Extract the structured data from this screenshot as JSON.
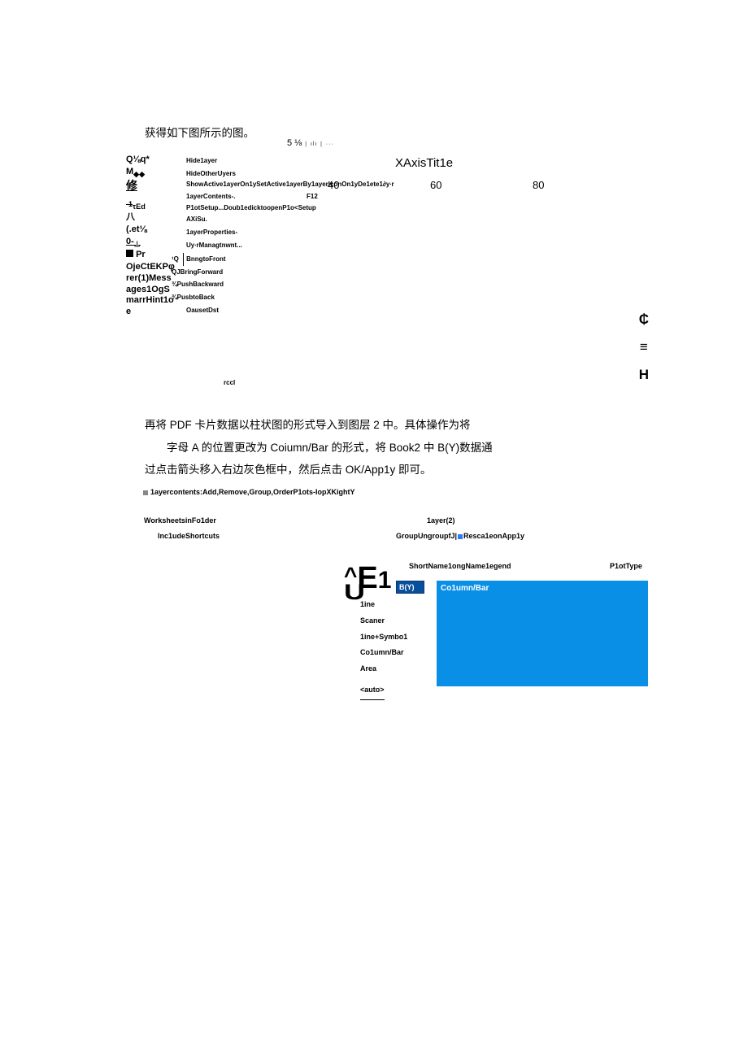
{
  "para1": "获得如下图所示的图。",
  "toprow": {
    "num": "5  ⅛",
    "bars": "∣ ılı ∣ ···"
  },
  "chart": {
    "title": "XAxisTit1e",
    "ticks": {
      "t40": "40",
      "t60": "60",
      "t80": "80"
    }
  },
  "leftcol": {
    "l1": "Q⅛q*",
    "l2a": "M",
    "l2b": "◆◆",
    "l3": "修",
    "l4a": "-1",
    "l4b": "τEd",
    "l5": "八",
    "l6": "(.et⅛",
    "l7": "0-",
    "l8": "Pr",
    "l9": "OjeCtEKPφrer(1)Messages1OgSmarrHint1oe"
  },
  "menu": {
    "m1": "Hide1ayer",
    "m2": "HideOtherUyers",
    "m3": "ShowActive1ayerOn1ySetActive1ayerBy1ayerIconOn1yDe1ete1∂y∙r",
    "m4": "1ayerContents-.",
    "m4s": "F12",
    "m5": "P1otSetup...Doub1edicktoopenP1o<Setup",
    "m6": "AXiSu.",
    "m7": "1ayerProperties-",
    "m8": "Uy∙rManagtnwnt...",
    "m9a": "¹Q",
    "m9b": "BnngtoFront",
    "m10": "QJBringForward",
    "m11": "¾PushBackward",
    "m12": "¾PusbtoBack",
    "m13": "OausetDst",
    "rccl": "rccl"
  },
  "rsym": {
    "s1": "₵",
    "s2": "≡",
    "s3": "H"
  },
  "para2": {
    "line1": "再将 PDF 卡片数据以柱状图的形式导入到图层 2 中。具体操作为将",
    "line2": "字母 A 的位置更改为 Coiumn/Bar 的形式，将 Book2 中 B(Y)数据通",
    "line3": "过点击箭头移入右边灰色框中，然后点击 OK/App1y 即可。"
  },
  "caption1": "1ayercontents:Add,Remove,Group,OrderP1ots-IopXKightY",
  "misc": {
    "worksheets": "WorksheetsinFo1der",
    "include": "Inc1udeShortcuts",
    "layer2": "1ayer(2)",
    "group": "GroupUngroupfJ|",
    "rescale": "Resca1eonApp1y"
  },
  "bigE": {
    "caret": "^",
    "e": "E",
    "one": "1",
    "u": "U"
  },
  "thead": {
    "c1": "ShortName1ongName1egend",
    "c2": "P1otType"
  },
  "cells": {
    "by": "B(Y)",
    "colbar": "Co1umn/Bar"
  },
  "plot_types": {
    "p1": "1ine",
    "p2": "Scaner",
    "p3": "1ine+Symbo1",
    "p4": "Co1umn/Bar",
    "p5": "Area",
    "p6": "<auto>"
  }
}
